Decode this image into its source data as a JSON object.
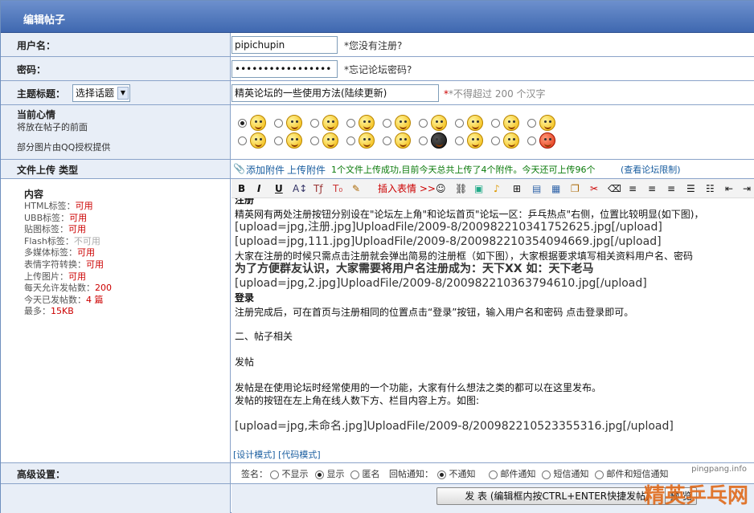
{
  "title": "编辑帖子",
  "username": {
    "label": "用户名：",
    "value": "pipichupin",
    "hint": "*您没有注册?"
  },
  "password": {
    "label": "密码：",
    "value": "•••••••••••••••••",
    "hint": "*忘记论坛密码?"
  },
  "topic": {
    "label": "主题标题：",
    "select": "选择话题",
    "value": "精英论坛的一些使用方法(陆续更新)",
    "hint": "*不得超过 200 个汉字"
  },
  "mood": {
    "label": "当前心情",
    "sub1": "将放在帖子的前面",
    "sub2": "部分图片由QQ授权提供"
  },
  "upload": {
    "label": "文件上传 类型",
    "add": "添加附件",
    "up": "上传附件",
    "status": "1个文件上传成功,目前今天总共上传了4个附件。今天还可上传96个",
    "limit": "(查看论坛限制)"
  },
  "content": {
    "label": "内容",
    "info": [
      {
        "k": "HTML标签：",
        "v": "可用"
      },
      {
        "k": "UBB标签：",
        "v": "可用"
      },
      {
        "k": "贴图标签：",
        "v": "可用"
      },
      {
        "k": "Flash标签：",
        "v": "不可用"
      },
      {
        "k": "多媒体标签：",
        "v": "可用"
      },
      {
        "k": "表情字符转换：",
        "v": "可用"
      },
      {
        "k": "上传图片：",
        "v": "可用"
      },
      {
        "k": "每天允许发帖数：",
        "v": "200"
      },
      {
        "k": "今天已发帖数：",
        "v": "4 篇"
      },
      {
        "k": "最多：",
        "v": "15KB"
      }
    ],
    "toolbar": {
      "insert": "插入表情 >>"
    },
    "lines": [
      "注册",
      "精英网有两处注册按钮分别设在\"论坛左上角\"和论坛首页\"论坛一区：乒乓热点\"右侧，位置比较明显(如下图)，",
      "[upload=jpg,注册.jpg]UploadFile/2009-8/200982210341752625.jpg[/upload]",
      "[upload=jpg,111.jpg]UploadFile/2009-8/200982210354094669.jpg[/upload]",
      "大家在注册的时候只需点击注册就会弹出简易的注册框（如下图），大家根据要求填写相关资料用户名、密码",
      "为了方便群友认识，大家需要将用户名注册成为：天下XX    如：天下老马",
      "[upload=jpg,2.jpg]UploadFile/2009-8/200982210363794610.jpg[/upload]",
      "登录",
      "注册完成后，可在首页与注册相同的位置点击“登录”按钮，输入用户名和密码 点击登录即可。",
      "二、帖子相关",
      "发帖",
      "发帖是在使用论坛时经常使用的一个功能，大家有什么想法之类的都可以在这里发布。",
      "发帖的按钮在左上角在线人数下方、栏目内容上方。如图:",
      "[upload=jpg,未命名.jpg]UploadFile/2009-8/200982210523355316.jpg[/upload]"
    ],
    "modes": "[设计模式] [代码模式]"
  },
  "advanced": {
    "label": "高级设置：",
    "sign": "签名：",
    "opts": [
      "不显示",
      "显示",
      "匿名"
    ],
    "notify": "回帖通知：",
    "nopts": [
      "不通知",
      "邮件通知",
      "短信通知",
      "邮件和短信通知"
    ]
  },
  "submit": "发 表 (编辑框内按CTRL+ENTER快捷发帖)",
  "preview": "预 览",
  "watermark": {
    "site": "pingpang.info",
    "text": "精英乒乓网"
  },
  "colors": {
    "accent": "#3f68b0",
    "red": "#cc0000",
    "link": "#1a5ea0"
  }
}
